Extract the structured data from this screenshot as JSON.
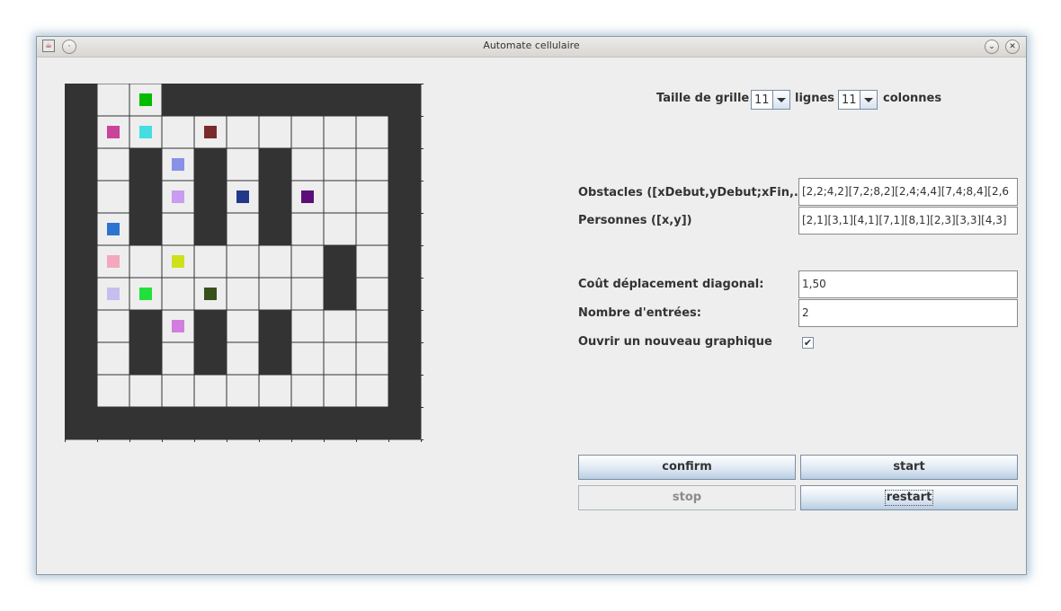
{
  "window": {
    "title": "Automate cellulaire",
    "app_icon": "java-app-icon",
    "menu_icon": "window-menu-icon",
    "minimize_icon": "minimize-icon",
    "close_icon": "close-icon"
  },
  "grid": {
    "rows": 11,
    "cols": 11,
    "wall_color": "#333333",
    "empty_color": "#eeeeee",
    "line_color": "#333333",
    "walls": [
      [
        0,
        0
      ],
      [
        0,
        3
      ],
      [
        0,
        4
      ],
      [
        0,
        5
      ],
      [
        0,
        6
      ],
      [
        0,
        7
      ],
      [
        0,
        8
      ],
      [
        0,
        9
      ],
      [
        0,
        10
      ],
      [
        1,
        0
      ],
      [
        1,
        10
      ],
      [
        2,
        0
      ],
      [
        2,
        2
      ],
      [
        2,
        4
      ],
      [
        2,
        6
      ],
      [
        2,
        10
      ],
      [
        3,
        0
      ],
      [
        3,
        2
      ],
      [
        3,
        4
      ],
      [
        3,
        6
      ],
      [
        3,
        10
      ],
      [
        4,
        0
      ],
      [
        4,
        2
      ],
      [
        4,
        4
      ],
      [
        4,
        6
      ],
      [
        4,
        10
      ],
      [
        5,
        0
      ],
      [
        5,
        8
      ],
      [
        5,
        10
      ],
      [
        6,
        0
      ],
      [
        6,
        8
      ],
      [
        6,
        10
      ],
      [
        7,
        0
      ],
      [
        7,
        2
      ],
      [
        7,
        4
      ],
      [
        7,
        6
      ],
      [
        7,
        10
      ],
      [
        8,
        0
      ],
      [
        8,
        2
      ],
      [
        8,
        4
      ],
      [
        8,
        6
      ],
      [
        8,
        10
      ],
      [
        9,
        0
      ],
      [
        9,
        10
      ],
      [
        10,
        0
      ],
      [
        10,
        1
      ],
      [
        10,
        2
      ],
      [
        10,
        3
      ],
      [
        10,
        4
      ],
      [
        10,
        5
      ],
      [
        10,
        6
      ],
      [
        10,
        7
      ],
      [
        10,
        8
      ],
      [
        10,
        9
      ],
      [
        10,
        10
      ]
    ],
    "persons": [
      {
        "row": 0,
        "col": 2,
        "color": "#00bb00"
      },
      {
        "row": 1,
        "col": 1,
        "color": "#c9449a"
      },
      {
        "row": 1,
        "col": 2,
        "color": "#44dde2"
      },
      {
        "row": 1,
        "col": 4,
        "color": "#7a2a2a"
      },
      {
        "row": 2,
        "col": 3,
        "color": "#8891e6"
      },
      {
        "row": 3,
        "col": 3,
        "color": "#c89cf0"
      },
      {
        "row": 3,
        "col": 5,
        "color": "#22398a"
      },
      {
        "row": 3,
        "col": 7,
        "color": "#5c0f78"
      },
      {
        "row": 4,
        "col": 1,
        "color": "#2d74d0"
      },
      {
        "row": 5,
        "col": 1,
        "color": "#f3a8be"
      },
      {
        "row": 5,
        "col": 3,
        "color": "#cde11c"
      },
      {
        "row": 6,
        "col": 1,
        "color": "#c5bff0"
      },
      {
        "row": 6,
        "col": 2,
        "color": "#22e03c"
      },
      {
        "row": 6,
        "col": 4,
        "color": "#38501a"
      },
      {
        "row": 7,
        "col": 3,
        "color": "#d17ee0"
      }
    ]
  },
  "grid_size": {
    "label": "Taille de grille",
    "rows_value": "11",
    "rows_label": "lignes",
    "cols_value": "11",
    "cols_label": "colonnes"
  },
  "form": {
    "obstacles_label": "Obstacles ([xDebut,yDebut;xFin,...",
    "obstacles_value": "[2,2;4,2][7,2;8,2][2,4;4,4][7,4;8,4][2,6",
    "persons_label": "Personnes ([x,y])",
    "persons_value": "[2,1][3,1][4,1][7,1][8,1][2,3][3,3][4,3]",
    "diag_cost_label": "Coût déplacement diagonal:",
    "diag_cost_value": "1,50",
    "entries_label": "Nombre d'entrées:",
    "entries_value": "2",
    "new_graph_label": "Ouvrir un nouveau graphique",
    "new_graph_checked": "✔"
  },
  "buttons": {
    "confirm": "confirm",
    "start": "start",
    "stop": "stop",
    "restart": "restart"
  }
}
